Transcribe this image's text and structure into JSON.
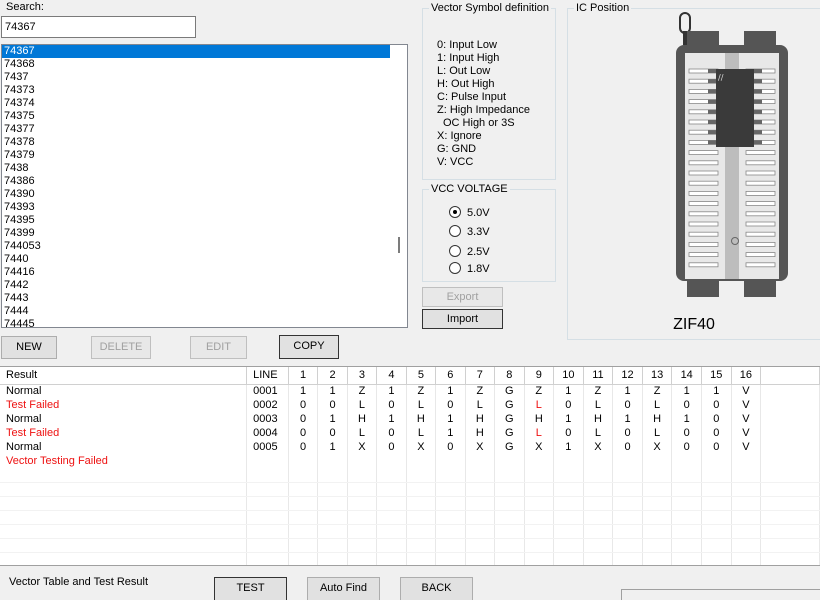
{
  "search": {
    "label": "Search:",
    "value": "74367"
  },
  "ic_list": {
    "items": [
      "74367",
      "74368",
      "7437",
      "74373",
      "74374",
      "74375",
      "74377",
      "74378",
      "74379",
      "7438",
      "74386",
      "74390",
      "74393",
      "74395",
      "74399",
      "744053",
      "7440",
      "74416",
      "7442",
      "7443",
      "7444",
      "74445"
    ],
    "selected": "74367"
  },
  "buttons": {
    "new": "NEW",
    "delete": "DELETE",
    "edit": "EDIT",
    "copy": "COPY",
    "export": "Export",
    "import": "Import",
    "test": "TEST",
    "auto_find": "Auto Find",
    "back": "BACK"
  },
  "vector_def": {
    "title": "Vector Symbol definition",
    "lines": [
      "0: Input Low",
      "1: Input High",
      "L: Out Low",
      "H: Out High",
      "C: Pulse Input",
      "Z: High Impedance",
      "OC High or 3S",
      "X: Ignore",
      "G: GND",
      "V: VCC"
    ]
  },
  "vcc": {
    "title": "VCC VOLTAGE",
    "options": [
      "5.0V",
      "3.3V",
      "2.5V",
      "1.8V"
    ],
    "selected": "5.0V"
  },
  "ic_position": {
    "title": "IC Position",
    "socket_label": "ZIF40"
  },
  "results": {
    "headers": [
      "Result",
      "LINE",
      "1",
      "2",
      "3",
      "4",
      "5",
      "6",
      "7",
      "8",
      "9",
      "10",
      "11",
      "12",
      "13",
      "14",
      "15",
      "16"
    ],
    "rows": [
      {
        "result": "Normal",
        "status": "normal",
        "line": "0001",
        "cells": [
          "1",
          "1",
          "Z",
          "1",
          "Z",
          "1",
          "Z",
          "G",
          "Z",
          "1",
          "Z",
          "1",
          "Z",
          "1",
          "1",
          "V"
        ]
      },
      {
        "result": "Test Failed",
        "status": "fail",
        "line": "0002",
        "cells": [
          "0",
          "0",
          "L",
          "0",
          "L",
          "0",
          "L",
          "G",
          "L",
          "0",
          "L",
          "0",
          "L",
          "0",
          "0",
          "V"
        ],
        "failed_pins": [
          9
        ]
      },
      {
        "result": "Normal",
        "status": "normal",
        "line": "0003",
        "cells": [
          "0",
          "1",
          "H",
          "1",
          "H",
          "1",
          "H",
          "G",
          "H",
          "1",
          "H",
          "1",
          "H",
          "1",
          "0",
          "V"
        ]
      },
      {
        "result": "Test Failed",
        "status": "fail",
        "line": "0004",
        "cells": [
          "0",
          "0",
          "L",
          "0",
          "L",
          "1",
          "H",
          "G",
          "L",
          "0",
          "L",
          "0",
          "L",
          "0",
          "0",
          "V"
        ],
        "failed_pins": [
          9
        ]
      },
      {
        "result": "Normal",
        "status": "normal",
        "line": "0005",
        "cells": [
          "0",
          "1",
          "X",
          "0",
          "X",
          "0",
          "X",
          "G",
          "X",
          "1",
          "X",
          "0",
          "X",
          "0",
          "0",
          "V"
        ]
      },
      {
        "result": "Vector Testing Failed",
        "status": "fail",
        "line": "",
        "cells": []
      }
    ]
  },
  "footer": {
    "label": "Vector Table and Test Result"
  },
  "colors": {
    "selection": "#0078d7",
    "fail": "#e11111",
    "window_bg": "#f0f0f0"
  }
}
